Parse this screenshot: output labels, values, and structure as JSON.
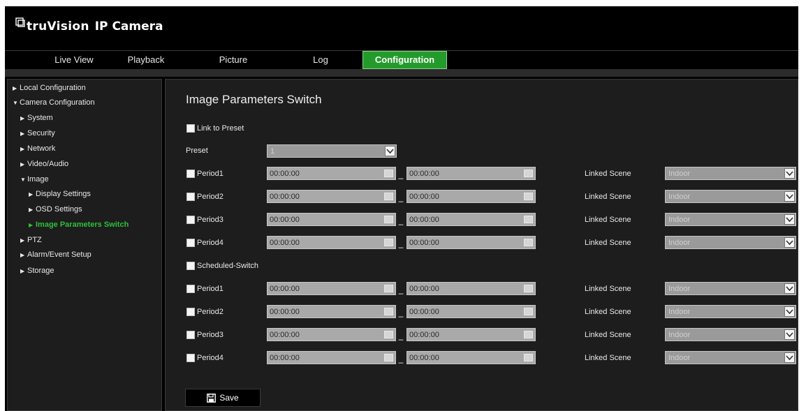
{
  "app": {
    "brand": "truVision",
    "product": "IP Camera"
  },
  "nav": {
    "tabs": [
      {
        "label": "Live View"
      },
      {
        "label": "Playback"
      },
      {
        "label": "Picture"
      },
      {
        "label": "Log"
      },
      {
        "label": "Configuration"
      }
    ],
    "active": "Configuration"
  },
  "sidebar": {
    "items": [
      {
        "label": "Local Configuration",
        "expanded": false
      },
      {
        "label": "Camera Configuration",
        "expanded": true
      },
      {
        "label": "System",
        "expanded": false
      },
      {
        "label": "Security",
        "expanded": false
      },
      {
        "label": "Network",
        "expanded": false
      },
      {
        "label": "Video/Audio",
        "expanded": false
      },
      {
        "label": "Image",
        "expanded": true
      },
      {
        "label": "Display Settings",
        "expanded": false
      },
      {
        "label": "OSD Settings",
        "expanded": false
      },
      {
        "label": "Image Parameters Switch",
        "expanded": false,
        "selected": true
      },
      {
        "label": "PTZ",
        "expanded": false
      },
      {
        "label": "Alarm/Event Setup",
        "expanded": false
      },
      {
        "label": "Storage",
        "expanded": false
      }
    ]
  },
  "main": {
    "title": "Image Parameters Switch",
    "link_to_preset": {
      "label": "Link to Preset",
      "checked": false
    },
    "preset": {
      "label": "Preset",
      "value": "1"
    },
    "preset_periods": [
      {
        "label": "Period1",
        "start": "00:00:00",
        "end": "00:00:00",
        "scene_label": "Linked Scene",
        "scene": "Indoor"
      },
      {
        "label": "Period2",
        "start": "00:00:00",
        "end": "00:00:00",
        "scene_label": "Linked Scene",
        "scene": "Indoor"
      },
      {
        "label": "Period3",
        "start": "00:00:00",
        "end": "00:00:00",
        "scene_label": "Linked Scene",
        "scene": "Indoor"
      },
      {
        "label": "Period4",
        "start": "00:00:00",
        "end": "00:00:00",
        "scene_label": "Linked Scene",
        "scene": "Indoor"
      }
    ],
    "scheduled_switch": {
      "label": "Scheduled-Switch",
      "checked": false
    },
    "scheduled_periods": [
      {
        "label": "Period1",
        "start": "00:00:00",
        "end": "00:00:00",
        "scene_label": "Linked Scene",
        "scene": "Indoor"
      },
      {
        "label": "Period2",
        "start": "00:00:00",
        "end": "00:00:00",
        "scene_label": "Linked Scene",
        "scene": "Indoor"
      },
      {
        "label": "Period3",
        "start": "00:00:00",
        "end": "00:00:00",
        "scene_label": "Linked Scene",
        "scene": "Indoor"
      },
      {
        "label": "Period4",
        "start": "00:00:00",
        "end": "00:00:00",
        "scene_label": "Linked Scene",
        "scene": "Indoor"
      }
    ],
    "save_label": "Save"
  },
  "colors": {
    "accent": "#239b2b",
    "selected_text": "#2fbf3a",
    "panel_bg": "#1d1d1d"
  },
  "icons": {
    "logo": "camera-logo-icon",
    "save": "floppy-disk-icon",
    "time": "calendar-icon",
    "dropdown": "chevron-down-icon",
    "tree": "triangle-arrow-icon"
  }
}
